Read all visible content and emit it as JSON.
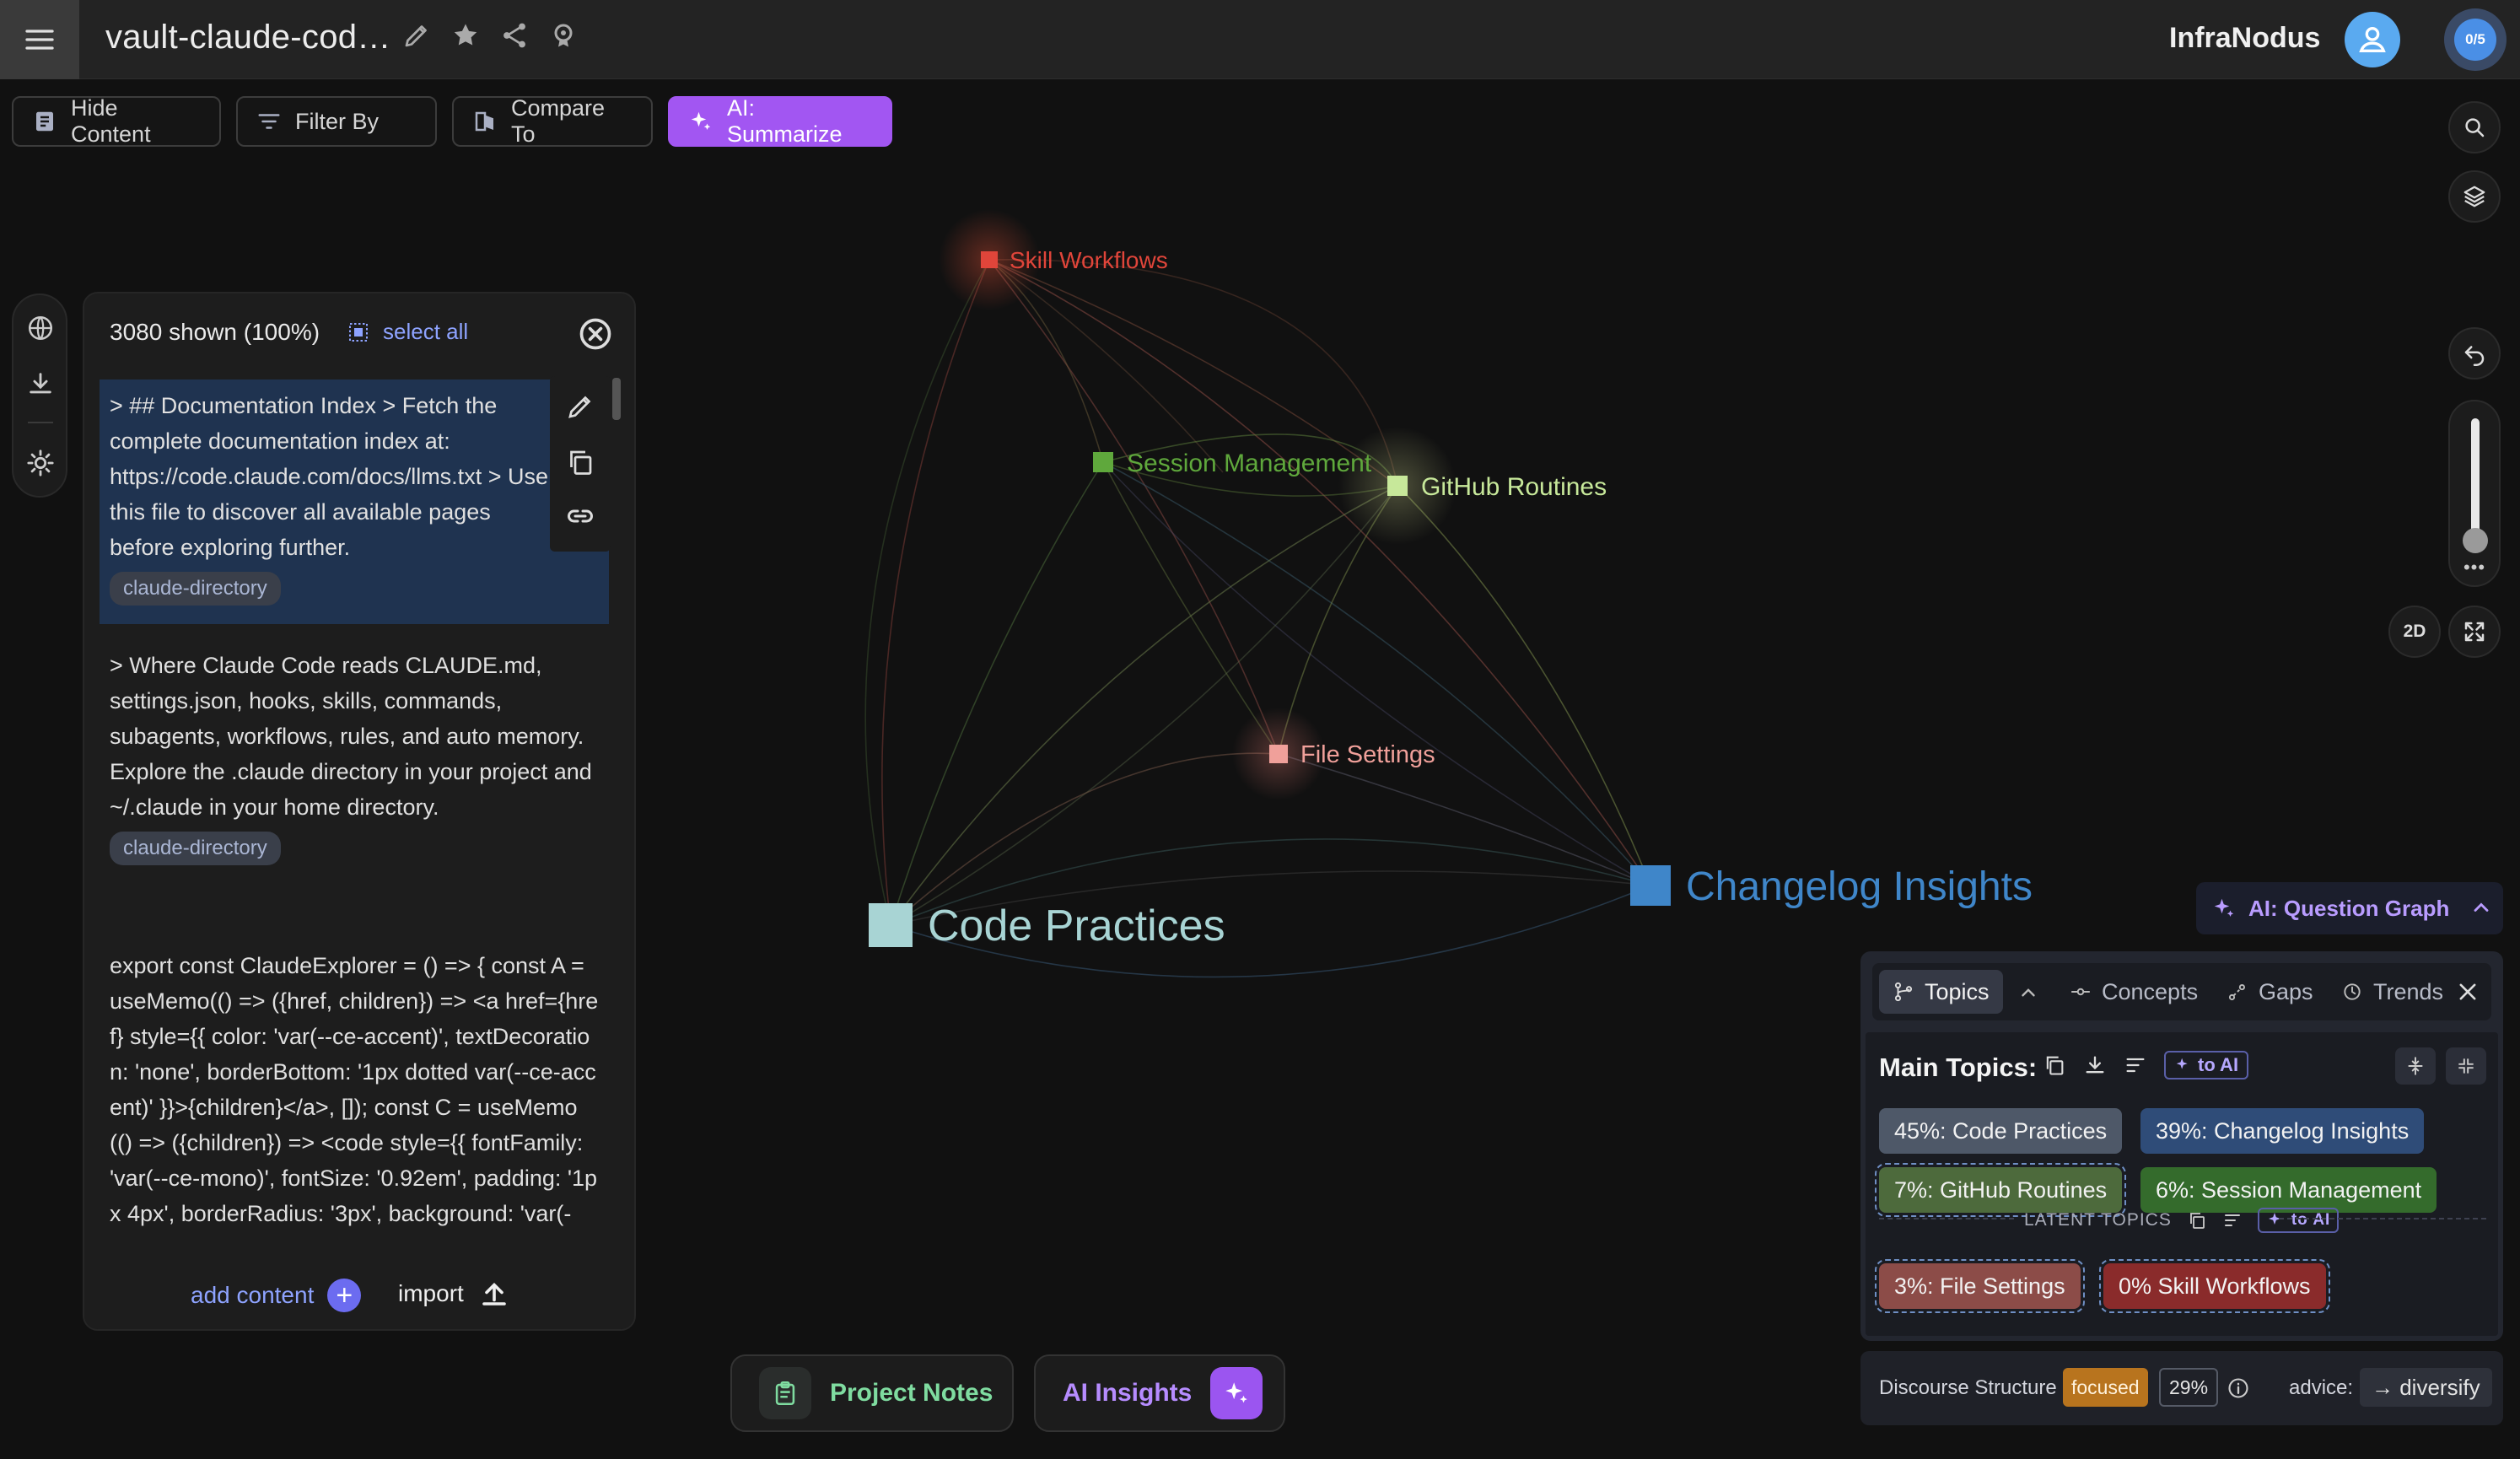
{
  "header": {
    "title": "vault-claude-cod…",
    "brand": "InfraNodus",
    "quota": "0/5"
  },
  "toolbar": {
    "hide_content": "Hide Content",
    "filter_by": "Filter By",
    "compare_to": "Compare To",
    "ai_summarize": "AI: Summarize"
  },
  "content_panel": {
    "shown": "3080 shown (100%)",
    "select_all": "select all",
    "entries": [
      {
        "text": "> ## Documentation Index > Fetch the complete documentation index at: https://code.claude.com/docs/llms.txt > Use this file to discover all available pages before exploring further.",
        "tag": "claude-directory"
      },
      {
        "text": "> Where Claude Code reads CLAUDE.md, settings.json, hooks, skills, commands, subagents, workflows, rules, and auto memory. Explore the .claude directory in your project and ~/.claude in your home directory.",
        "tag": "claude-directory"
      },
      {
        "text": "export const ClaudeExplorer = () => { const A = useMemo(() => ({href, children}) => <a href={href} style={{ color: 'var(--ce-accent)', textDecoration: 'none', borderBottom: '1px dotted var(--ce-accent)' }}>{children}</a>, []); const C = useMemo(() => ({children}) => <code style={{ fontFamily: 'var(--ce-mono)', fontSize: '0.92em', padding: '1px 4px', borderRadius: '3px', background: 'var(-"
      }
    ],
    "add_content": "add content",
    "import": "import"
  },
  "graph": {
    "nodes": [
      {
        "label": "Skill Workflows",
        "color": "#e0453a"
      },
      {
        "label": "Session Management",
        "color": "#5fa83c"
      },
      {
        "label": "GitHub Routines",
        "color": "#c7e89a"
      },
      {
        "label": "File Settings",
        "color": "#f0a09a"
      },
      {
        "label": "Code Practices",
        "color": "#a8d4d4"
      },
      {
        "label": "Changelog Insights",
        "color": "#3f86c9"
      }
    ]
  },
  "ai_question_graph": "AI: Question Graph",
  "analytics": {
    "tabs": [
      "Topics",
      "Concepts",
      "Gaps",
      "Trends"
    ],
    "main_topics_label": "Main Topics:",
    "to_ai": "to AI",
    "topics": [
      {
        "label": "45%: Code Practices",
        "color": "#4e5868"
      },
      {
        "label": "39%: Changelog Insights",
        "color": "#2f4c78"
      },
      {
        "label": "7%: GitHub Routines",
        "color": "#4d6a3c"
      },
      {
        "label": "6%: Session Management",
        "color": "#346b2c"
      }
    ],
    "latent_label": "LATENT TOPICS",
    "latent_topics": [
      {
        "label": "3%: File Settings",
        "color": "#8c4c48"
      },
      {
        "label": "0% Skill Workflows",
        "color": "#8a2b2b"
      }
    ]
  },
  "discourse": {
    "label": "Discourse Structure",
    "status": "focused",
    "percent": "29%",
    "advice_label": "advice:",
    "advice": "→ diversify"
  },
  "bottom": {
    "project_notes": "Project Notes",
    "ai_insights": "AI Insights"
  }
}
